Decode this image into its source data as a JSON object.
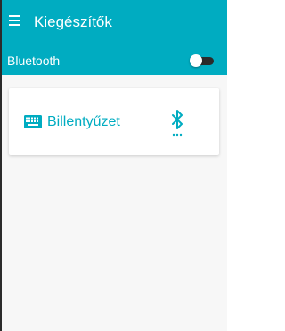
{
  "appbar": {
    "title": "Kiegészítők",
    "menu_icon": "hamburger-menu-icon"
  },
  "bluetooth": {
    "label": "Bluetooth",
    "enabled": false
  },
  "devices": [
    {
      "name": "Billentyűzet",
      "type_icon": "keyboard-icon",
      "status_icon": "bluetooth-searching-icon"
    }
  ],
  "colors": {
    "accent": "#00acc1",
    "on_accent": "#ffffff",
    "background": "#f7f7f7",
    "card": "#ffffff",
    "toggle_track_off": "#2b2b2b"
  }
}
